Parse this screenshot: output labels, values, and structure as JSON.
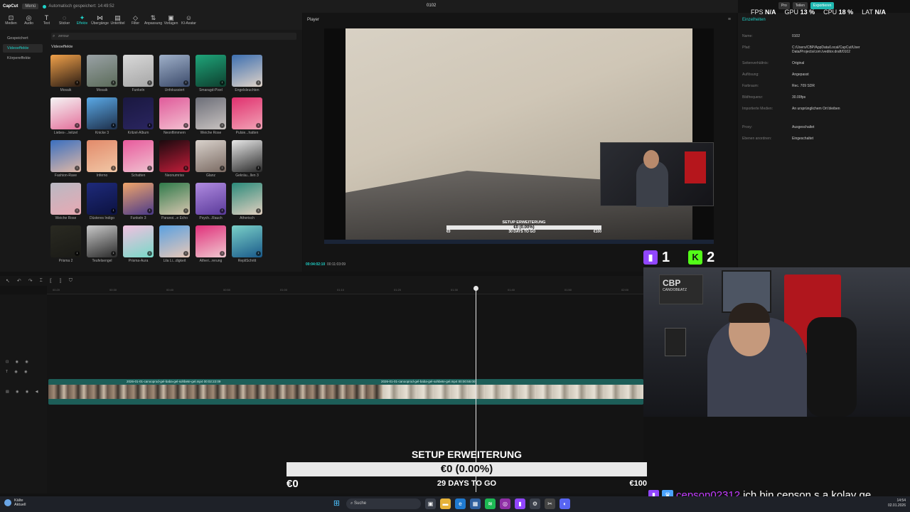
{
  "app": {
    "logo": "CapCut",
    "menu": "Menü",
    "autosave": "Automatisch gespeichert: 14:49:52",
    "project_title": "0102",
    "pro": "Pro",
    "share": "Teilen",
    "export": "Exportieren"
  },
  "toolbar": [
    {
      "icon": "⊡",
      "label": "Medien"
    },
    {
      "icon": "◎",
      "label": "Audio"
    },
    {
      "icon": "T",
      "label": "Text"
    },
    {
      "icon": "◌",
      "label": "Sticker"
    },
    {
      "icon": "✦",
      "label": "Effekte"
    },
    {
      "icon": "⋈",
      "label": "Übergänge"
    },
    {
      "icon": "▤",
      "label": "Untertitel"
    },
    {
      "icon": "◇",
      "label": "Filter"
    },
    {
      "icon": "⇅",
      "label": "Anpassung"
    },
    {
      "icon": "▣",
      "label": "Vorlagen"
    },
    {
      "icon": "☺",
      "label": "KI-Avatar"
    }
  ],
  "sidenav": {
    "saved": "Gespeichert",
    "video_effects": "Videoeffekte",
    "body_effects": "Körpereffekte"
  },
  "effects": {
    "search_value": "zensur",
    "heading": "Videoeffekte",
    "items": [
      {
        "label": "Mosaik",
        "colors": [
          "#f1a14a",
          "#2a1c14"
        ]
      },
      {
        "label": "Mosaik",
        "colors": [
          "#9aa2a6",
          "#5b6b59"
        ]
      },
      {
        "label": "Funkeln",
        "colors": [
          "#d9d9d9",
          "#a5a5a5"
        ]
      },
      {
        "label": "Unfokussiert",
        "colors": [
          "#9fb0c9",
          "#3b4a6a"
        ]
      },
      {
        "label": "Smaragd-Pixel",
        "colors": [
          "#1fa57a",
          "#0d3f2e"
        ]
      },
      {
        "label": "Engelsleuchten",
        "colors": [
          "#3d6fb0",
          "#e0d3c8"
        ]
      },
      {
        "label": "Liebes-...leitzel",
        "colors": [
          "#f5f5f5",
          "#e46f9a"
        ]
      },
      {
        "label": "Knicke 3",
        "colors": [
          "#5aa9e6",
          "#1e2f4a"
        ]
      },
      {
        "label": "Kritzel-Album",
        "colors": [
          "#1a1840",
          "#2a2560"
        ]
      },
      {
        "label": "Neonflimmern",
        "colors": [
          "#e05a9a",
          "#f3c0d0"
        ]
      },
      {
        "label": "Weiche Rose",
        "colors": [
          "#6c6e78",
          "#c9c3c1"
        ]
      },
      {
        "label": "Pulsie...hatten",
        "colors": [
          "#e0306e",
          "#f2a3b6"
        ]
      },
      {
        "label": "Fashion-Rave",
        "colors": [
          "#3a6fc0",
          "#e0b8a6"
        ]
      },
      {
        "label": "Inferno",
        "colors": [
          "#e28a6a",
          "#f1c7a6"
        ]
      },
      {
        "label": "Schatten",
        "colors": [
          "#e85a9c",
          "#f0c1d0"
        ]
      },
      {
        "label": "Neonumriss",
        "colors": [
          "#1a0a0e",
          "#c41d3a"
        ]
      },
      {
        "label": "Glanz",
        "colors": [
          "#d9d2cc",
          "#7a6a62"
        ]
      },
      {
        "label": "Gekräu...llen 3",
        "colors": [
          "#e8e8e8",
          "#2a2a2a"
        ]
      },
      {
        "label": "Weiche Rose",
        "colors": [
          "#b9b9c3",
          "#e8a9b3"
        ]
      },
      {
        "label": "Düsteres Indigo",
        "colors": [
          "#1e2a7a",
          "#0c1240"
        ]
      },
      {
        "label": "Funkeln 3",
        "colors": [
          "#f0a56a",
          "#4a3a8a"
        ]
      },
      {
        "label": "Paranoi...e Echo",
        "colors": [
          "#2f7a4a",
          "#d8c6b0"
        ]
      },
      {
        "label": "Psych...Rauch",
        "colors": [
          "#b08be0",
          "#5a3a9a"
        ]
      },
      {
        "label": "Ätherisch",
        "colors": [
          "#2a8a7a",
          "#e3d0c0"
        ]
      },
      {
        "label": "Prisma 2",
        "colors": [
          "#2a2a22",
          "#1a1a16"
        ]
      },
      {
        "label": "Teufelsengel",
        "colors": [
          "#c9c9c9",
          "#2a2a2a"
        ]
      },
      {
        "label": "Prisma-Aura",
        "colors": [
          "#f2c0e0",
          "#78d9c8"
        ]
      },
      {
        "label": "Lila Li...digkeit",
        "colors": [
          "#5aa0e0",
          "#e8c8b8"
        ]
      },
      {
        "label": "Ätheri...rerung",
        "colors": [
          "#e0307a",
          "#f0c8d0"
        ]
      },
      {
        "label": "RepliSchritt",
        "colors": [
          "#7ad0c8",
          "#1a5a8a"
        ]
      }
    ]
  },
  "player": {
    "title": "Player",
    "time_current": "00:04:02:10",
    "time_total": "00:11:03:09",
    "goal_title": "SETUP ERWEITERUNG",
    "goal_value": "€0 (0.00%)",
    "goal_left": "€0",
    "goal_days": "30 DAYS TO GO",
    "goal_right": "€100"
  },
  "details": {
    "tab": "Einzelheiten",
    "rows": [
      {
        "k": "Name:",
        "v": "0102"
      },
      {
        "k": "Pfad:",
        "v": "C:/Users/CBP/AppData/Local/CapCut/User Data/Projects/com.lveditor.draft/0102"
      },
      {
        "k": "Seitenverhältnis:",
        "v": "Original"
      },
      {
        "k": "Auflösung:",
        "v": "Angepasst"
      },
      {
        "k": "Farbraum:",
        "v": "Rec. 709 SDR"
      },
      {
        "k": "Bildfrequenz:",
        "v": "30.00fps"
      },
      {
        "k": "Importierte Medien:",
        "v": "An ursprünglichem Ort bleiben"
      },
      {
        "k": "Proxy:",
        "v": "Ausgeschaltet"
      },
      {
        "k": "Ebenen anordnen:",
        "v": "Eingeschaltet"
      }
    ],
    "edit": "Ändern"
  },
  "stats": {
    "fps_k": "FPS",
    "fps_v": "N/A",
    "gpu_k": "GPU",
    "gpu_v": "13 %",
    "cpu_k": "CPU",
    "cpu_v": "18 %",
    "lat_k": "LAT",
    "lat_v": "N/A"
  },
  "counter": {
    "twitch": "1",
    "kick": "2"
  },
  "timeline": {
    "ticks": [
      "00:20",
      "00:30",
      "00:40",
      "00:50",
      "01:00",
      "01:10",
      "01:20",
      "01:30",
      "01:40",
      "01:50",
      "02:00"
    ],
    "clip1_name": "2026-01-01-canooprod-gel-baba-gel-sohbete-gel.mp4  00:02:22:09",
    "clip2_name": "2026-01-01-canooprod-gel-baba-gel-sohbete-gel.mp4  00:00:55:00"
  },
  "overlay_goal": {
    "title": "SETUP ERWEITERUNG",
    "value": "€0 (0.00%)",
    "left": "€0",
    "days": "29 DAYS TO GO",
    "right": "€100"
  },
  "chat": {
    "user": "cepson02312",
    "message": "ich bin cepson s.a kolay ge"
  },
  "taskbar": {
    "weather_temp": "Kälte",
    "weather_sub": "Aktuell",
    "search": "Suche",
    "time": "14:54",
    "date": "02.01.2026"
  }
}
